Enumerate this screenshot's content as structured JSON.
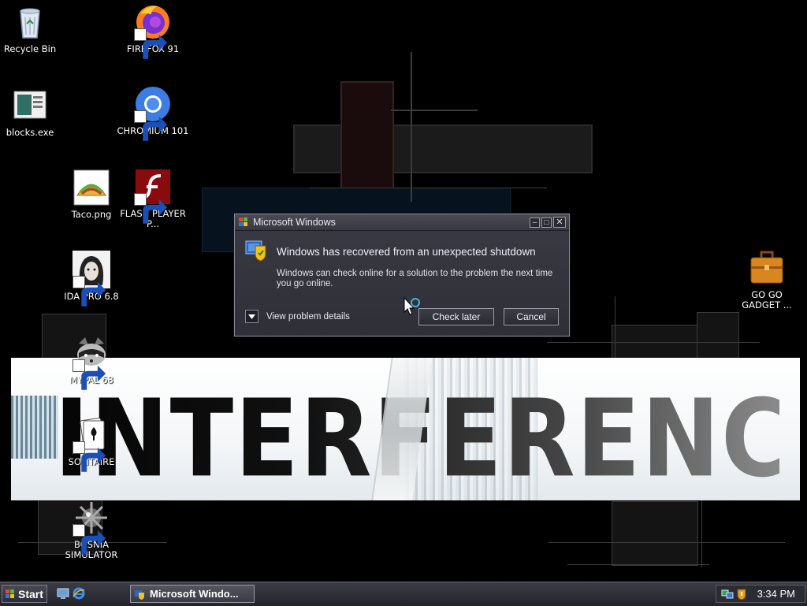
{
  "desktop": {
    "icons": [
      {
        "label": "Recycle Bin"
      },
      {
        "label": "FIREFOX 91"
      },
      {
        "label": "blocks.exe"
      },
      {
        "label": "CHROMIUM 101"
      },
      {
        "label": "Taco.png"
      },
      {
        "label": "FLASH PLAYER P..."
      },
      {
        "label": "IDA PRO 6.8"
      },
      {
        "label": "MYPAL 68"
      },
      {
        "label": "SOLITAIRE"
      },
      {
        "label": "BOSNIA SIMULATOR"
      },
      {
        "label": "GO GO GADGET ..."
      }
    ],
    "wallpaper_text": "INTERFERENCE"
  },
  "dialog": {
    "title": "Microsoft Windows",
    "heading": "Windows has recovered from an unexpected shutdown",
    "body": "Windows can check online for a solution to the problem the next time you go online.",
    "details_label": "View problem details",
    "check_later_label": "Check later",
    "cancel_label": "Cancel"
  },
  "taskbar": {
    "start_label": "Start",
    "task_label": "Microsoft Windo...",
    "clock": "3:34 PM"
  },
  "colors": {
    "dialog_bg": "#33333c",
    "taskbar_bg": "#2b2b33",
    "accent": "#0b3a5a"
  }
}
